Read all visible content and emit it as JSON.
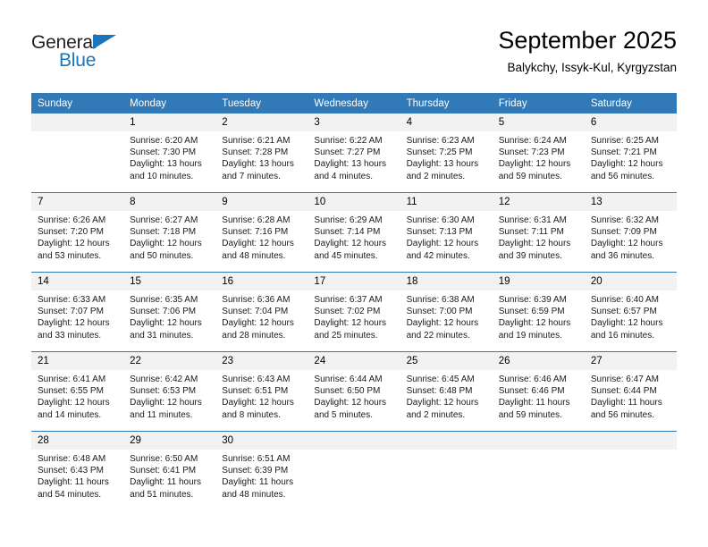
{
  "brand": {
    "name_part1": "General",
    "name_part2": "Blue",
    "accent_color": "#1b75bb"
  },
  "header": {
    "month_title": "September 2025",
    "location": "Balykchy, Issyk-Kul, Kyrgyzstan"
  },
  "calendar": {
    "header_bg": "#3279b7",
    "daynum_bg": "#f2f2f2",
    "weekday_headers": [
      "Sunday",
      "Monday",
      "Tuesday",
      "Wednesday",
      "Thursday",
      "Friday",
      "Saturday"
    ],
    "weeks": [
      [
        {
          "day": "",
          "lines": []
        },
        {
          "day": "1",
          "lines": [
            "Sunrise: 6:20 AM",
            "Sunset: 7:30 PM",
            "Daylight: 13 hours",
            "and 10 minutes."
          ]
        },
        {
          "day": "2",
          "lines": [
            "Sunrise: 6:21 AM",
            "Sunset: 7:28 PM",
            "Daylight: 13 hours",
            "and 7 minutes."
          ]
        },
        {
          "day": "3",
          "lines": [
            "Sunrise: 6:22 AM",
            "Sunset: 7:27 PM",
            "Daylight: 13 hours",
            "and 4 minutes."
          ]
        },
        {
          "day": "4",
          "lines": [
            "Sunrise: 6:23 AM",
            "Sunset: 7:25 PM",
            "Daylight: 13 hours",
            "and 2 minutes."
          ]
        },
        {
          "day": "5",
          "lines": [
            "Sunrise: 6:24 AM",
            "Sunset: 7:23 PM",
            "Daylight: 12 hours",
            "and 59 minutes."
          ]
        },
        {
          "day": "6",
          "lines": [
            "Sunrise: 6:25 AM",
            "Sunset: 7:21 PM",
            "Daylight: 12 hours",
            "and 56 minutes."
          ]
        }
      ],
      [
        {
          "day": "7",
          "lines": [
            "Sunrise: 6:26 AM",
            "Sunset: 7:20 PM",
            "Daylight: 12 hours",
            "and 53 minutes."
          ]
        },
        {
          "day": "8",
          "lines": [
            "Sunrise: 6:27 AM",
            "Sunset: 7:18 PM",
            "Daylight: 12 hours",
            "and 50 minutes."
          ]
        },
        {
          "day": "9",
          "lines": [
            "Sunrise: 6:28 AM",
            "Sunset: 7:16 PM",
            "Daylight: 12 hours",
            "and 48 minutes."
          ]
        },
        {
          "day": "10",
          "lines": [
            "Sunrise: 6:29 AM",
            "Sunset: 7:14 PM",
            "Daylight: 12 hours",
            "and 45 minutes."
          ]
        },
        {
          "day": "11",
          "lines": [
            "Sunrise: 6:30 AM",
            "Sunset: 7:13 PM",
            "Daylight: 12 hours",
            "and 42 minutes."
          ]
        },
        {
          "day": "12",
          "lines": [
            "Sunrise: 6:31 AM",
            "Sunset: 7:11 PM",
            "Daylight: 12 hours",
            "and 39 minutes."
          ]
        },
        {
          "day": "13",
          "lines": [
            "Sunrise: 6:32 AM",
            "Sunset: 7:09 PM",
            "Daylight: 12 hours",
            "and 36 minutes."
          ]
        }
      ],
      [
        {
          "day": "14",
          "lines": [
            "Sunrise: 6:33 AM",
            "Sunset: 7:07 PM",
            "Daylight: 12 hours",
            "and 33 minutes."
          ]
        },
        {
          "day": "15",
          "lines": [
            "Sunrise: 6:35 AM",
            "Sunset: 7:06 PM",
            "Daylight: 12 hours",
            "and 31 minutes."
          ]
        },
        {
          "day": "16",
          "lines": [
            "Sunrise: 6:36 AM",
            "Sunset: 7:04 PM",
            "Daylight: 12 hours",
            "and 28 minutes."
          ]
        },
        {
          "day": "17",
          "lines": [
            "Sunrise: 6:37 AM",
            "Sunset: 7:02 PM",
            "Daylight: 12 hours",
            "and 25 minutes."
          ]
        },
        {
          "day": "18",
          "lines": [
            "Sunrise: 6:38 AM",
            "Sunset: 7:00 PM",
            "Daylight: 12 hours",
            "and 22 minutes."
          ]
        },
        {
          "day": "19",
          "lines": [
            "Sunrise: 6:39 AM",
            "Sunset: 6:59 PM",
            "Daylight: 12 hours",
            "and 19 minutes."
          ]
        },
        {
          "day": "20",
          "lines": [
            "Sunrise: 6:40 AM",
            "Sunset: 6:57 PM",
            "Daylight: 12 hours",
            "and 16 minutes."
          ]
        }
      ],
      [
        {
          "day": "21",
          "lines": [
            "Sunrise: 6:41 AM",
            "Sunset: 6:55 PM",
            "Daylight: 12 hours",
            "and 14 minutes."
          ]
        },
        {
          "day": "22",
          "lines": [
            "Sunrise: 6:42 AM",
            "Sunset: 6:53 PM",
            "Daylight: 12 hours",
            "and 11 minutes."
          ]
        },
        {
          "day": "23",
          "lines": [
            "Sunrise: 6:43 AM",
            "Sunset: 6:51 PM",
            "Daylight: 12 hours",
            "and 8 minutes."
          ]
        },
        {
          "day": "24",
          "lines": [
            "Sunrise: 6:44 AM",
            "Sunset: 6:50 PM",
            "Daylight: 12 hours",
            "and 5 minutes."
          ]
        },
        {
          "day": "25",
          "lines": [
            "Sunrise: 6:45 AM",
            "Sunset: 6:48 PM",
            "Daylight: 12 hours",
            "and 2 minutes."
          ]
        },
        {
          "day": "26",
          "lines": [
            "Sunrise: 6:46 AM",
            "Sunset: 6:46 PM",
            "Daylight: 11 hours",
            "and 59 minutes."
          ]
        },
        {
          "day": "27",
          "lines": [
            "Sunrise: 6:47 AM",
            "Sunset: 6:44 PM",
            "Daylight: 11 hours",
            "and 56 minutes."
          ]
        }
      ],
      [
        {
          "day": "28",
          "lines": [
            "Sunrise: 6:48 AM",
            "Sunset: 6:43 PM",
            "Daylight: 11 hours",
            "and 54 minutes."
          ]
        },
        {
          "day": "29",
          "lines": [
            "Sunrise: 6:50 AM",
            "Sunset: 6:41 PM",
            "Daylight: 11 hours",
            "and 51 minutes."
          ]
        },
        {
          "day": "30",
          "lines": [
            "Sunrise: 6:51 AM",
            "Sunset: 6:39 PM",
            "Daylight: 11 hours",
            "and 48 minutes."
          ]
        },
        {
          "day": "",
          "lines": []
        },
        {
          "day": "",
          "lines": []
        },
        {
          "day": "",
          "lines": []
        },
        {
          "day": "",
          "lines": []
        }
      ]
    ]
  }
}
